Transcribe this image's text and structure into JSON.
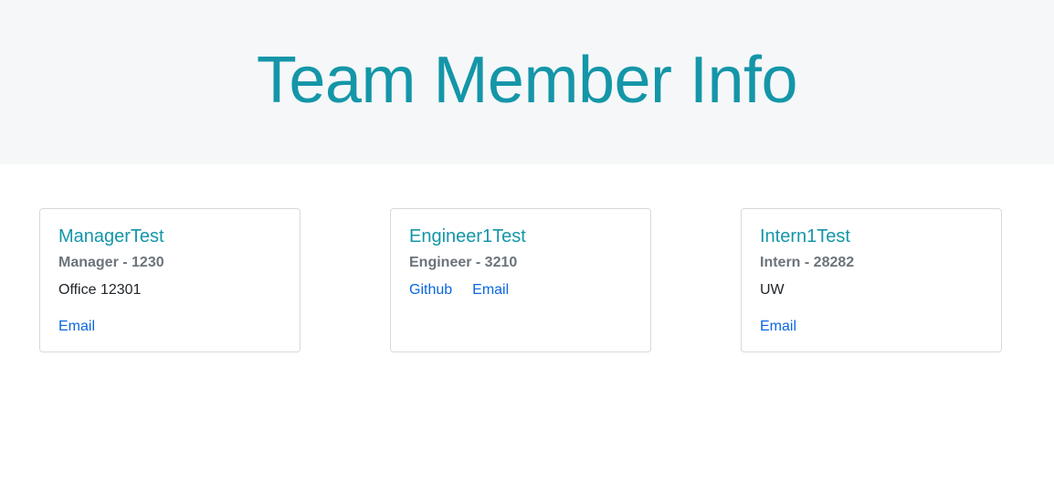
{
  "header": {
    "title": "Team Member Info"
  },
  "colors": {
    "accent": "#1496a8",
    "link": "#0a67e0",
    "subtitle": "#6c737b",
    "header_bg": "#f6f7f9"
  },
  "cards": [
    {
      "name": "ManagerTest",
      "role": "Manager - 1230",
      "detail": "Office 12301",
      "email_label": "Email"
    },
    {
      "name": "Engineer1Test",
      "role": "Engineer - 3210",
      "github_label": "Github",
      "email_label": "Email"
    },
    {
      "name": "Intern1Test",
      "role": "Intern - 28282",
      "detail": "UW",
      "email_label": "Email"
    }
  ]
}
